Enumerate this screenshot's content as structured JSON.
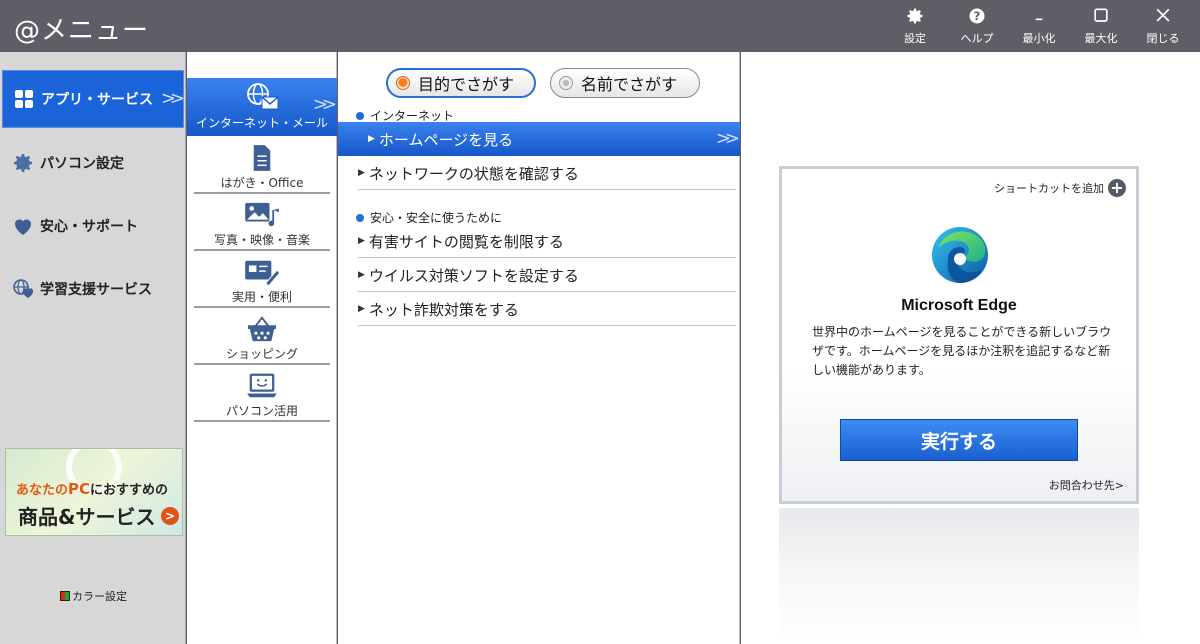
{
  "window": {
    "title": "@メニュー",
    "buttons": [
      {
        "id": "settings",
        "label": "設定",
        "icon": "gear-icon"
      },
      {
        "id": "help",
        "label": "ヘルプ",
        "icon": "help-icon"
      },
      {
        "id": "minimize",
        "label": "最小化",
        "icon": "minimize-icon"
      },
      {
        "id": "maximize",
        "label": "最大化",
        "icon": "maximize-icon"
      },
      {
        "id": "close",
        "label": "閉じる",
        "icon": "close-icon"
      }
    ]
  },
  "sidebar": {
    "items": [
      {
        "label": "アプリ・サービス",
        "icon": "apps-grid-icon",
        "active": true
      },
      {
        "label": "パソコン設定",
        "icon": "gear-icon",
        "active": false
      },
      {
        "label": "安心・サポート",
        "icon": "heart-icon",
        "active": false
      },
      {
        "label": "学習支援サービス",
        "icon": "globe-heart-icon",
        "active": false
      }
    ],
    "banner": {
      "line1_prefix": "あなたの",
      "line1_pc": "PC",
      "line1_suffix": "におすすめの",
      "line2": "商品&サービス"
    },
    "color_setting_label": "カラー設定"
  },
  "categories": {
    "items": [
      {
        "label": "インターネット・メール",
        "icon": "globe-mail-icon",
        "active": true
      },
      {
        "label": "はがき・Office",
        "icon": "document-icon",
        "active": false
      },
      {
        "label": "写真・映像・音楽",
        "icon": "photo-music-icon",
        "active": false
      },
      {
        "label": "実用・便利",
        "icon": "card-pen-icon",
        "active": false
      },
      {
        "label": "ショッピング",
        "icon": "basket-icon",
        "active": false
      },
      {
        "label": "パソコン活用",
        "icon": "laptop-smile-icon",
        "active": false
      }
    ]
  },
  "search": {
    "by_purpose_label": "目的でさがす",
    "by_name_label": "名前でさがす",
    "selected": "by_purpose"
  },
  "tasks": {
    "sections": [
      {
        "heading": "インターネット",
        "items": [
          {
            "label": "ホームページを見る",
            "active": true
          },
          {
            "label": "ネットワークの状態を確認する",
            "active": false
          }
        ]
      },
      {
        "heading": "安心・安全に使うために",
        "items": [
          {
            "label": "有害サイトの閲覧を制限する",
            "active": false
          },
          {
            "label": "ウイルス対策ソフトを設定する",
            "active": false
          },
          {
            "label": "ネット詐欺対策をする",
            "active": false
          }
        ]
      }
    ]
  },
  "detail": {
    "shortcut_label": "ショートカットを追加",
    "app_name": "Microsoft Edge",
    "description": "世界中のホームページを見ることができる新しいブラウザです。ホームページを見るほか注釈を追記するなど新しい機能があります。",
    "run_label": "実行する",
    "contact_label": "お問合わせ先>"
  },
  "colors": {
    "accent": "#1b63d9",
    "titlebar": "#5f5e66",
    "sidebar_bg": "#d7d7d7"
  }
}
